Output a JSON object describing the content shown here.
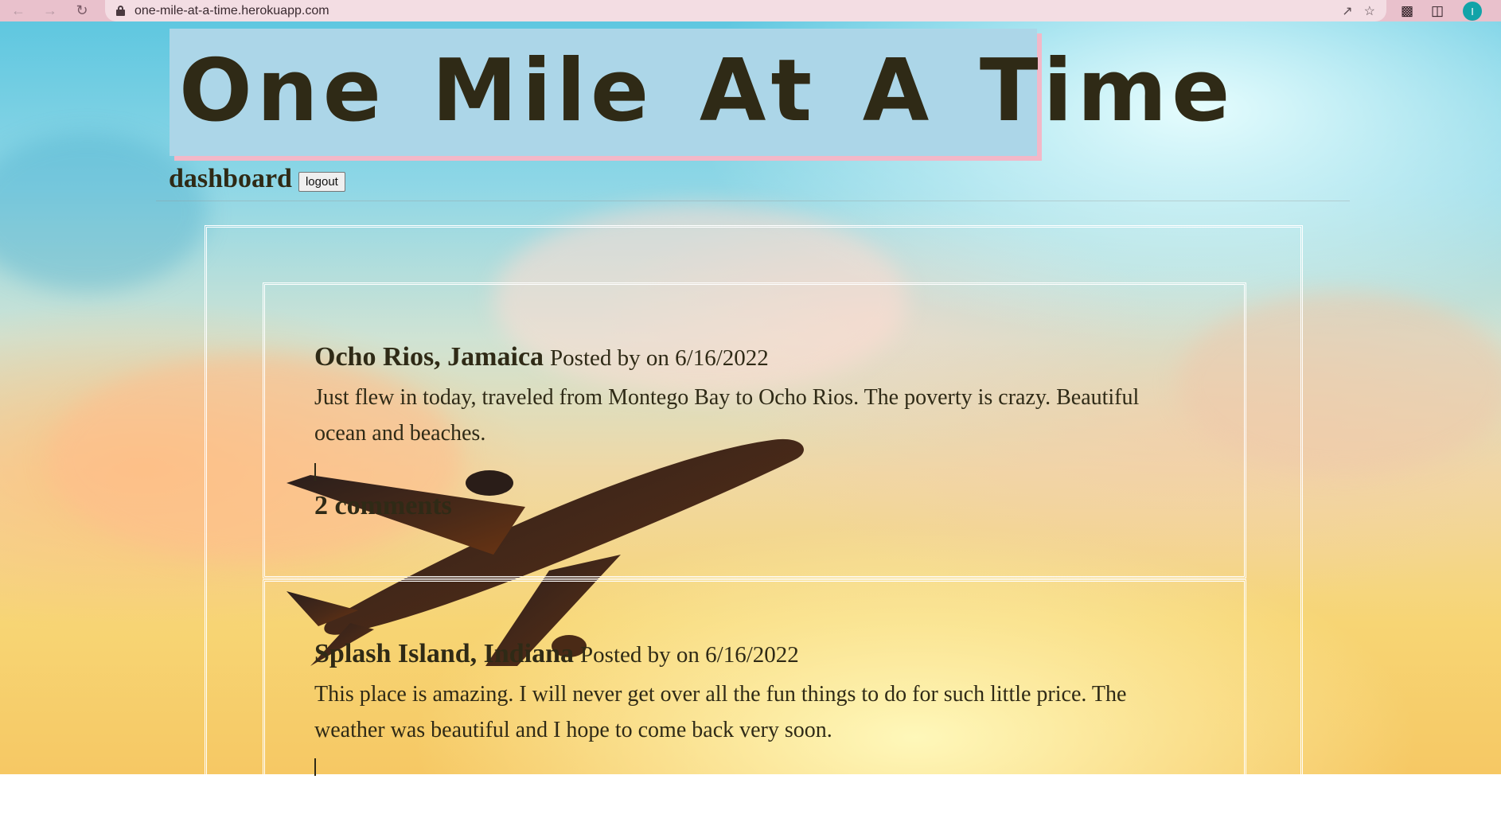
{
  "browser": {
    "url": "one-mile-at-a-time.herokuapp.com",
    "avatar_initial": "I",
    "icons": [
      "back-arrow-icon",
      "forward-arrow-icon",
      "reload-icon",
      "lock-icon",
      "share-icon",
      "star-icon",
      "extensions-icon",
      "side-panel-icon"
    ]
  },
  "header": {
    "site_title": "One Mile At A Time",
    "dashboard_label": "dashboard",
    "logout_label": "logout"
  },
  "posts": [
    {
      "title": "Ocho Rios, Jamaica",
      "meta": "Posted by on 6/16/2022",
      "body": "Just flew in today, traveled from Montego Bay to Ocho Rios. The poverty is crazy. Beautiful ocean and beaches.",
      "comments": "2 comments"
    },
    {
      "title": "Splash Island, Indiana",
      "meta": "Posted by on 6/16/2022",
      "body": "This place is amazing. I will never get over all the fun things to do for such little price. The weather was beautiful and I hope to come back very soon."
    }
  ],
  "colors": {
    "header_bg": "#acd6e8",
    "header_shadow": "#f3b8c8",
    "text": "#2f2a16",
    "chrome_bg": "#e9c1cc"
  }
}
